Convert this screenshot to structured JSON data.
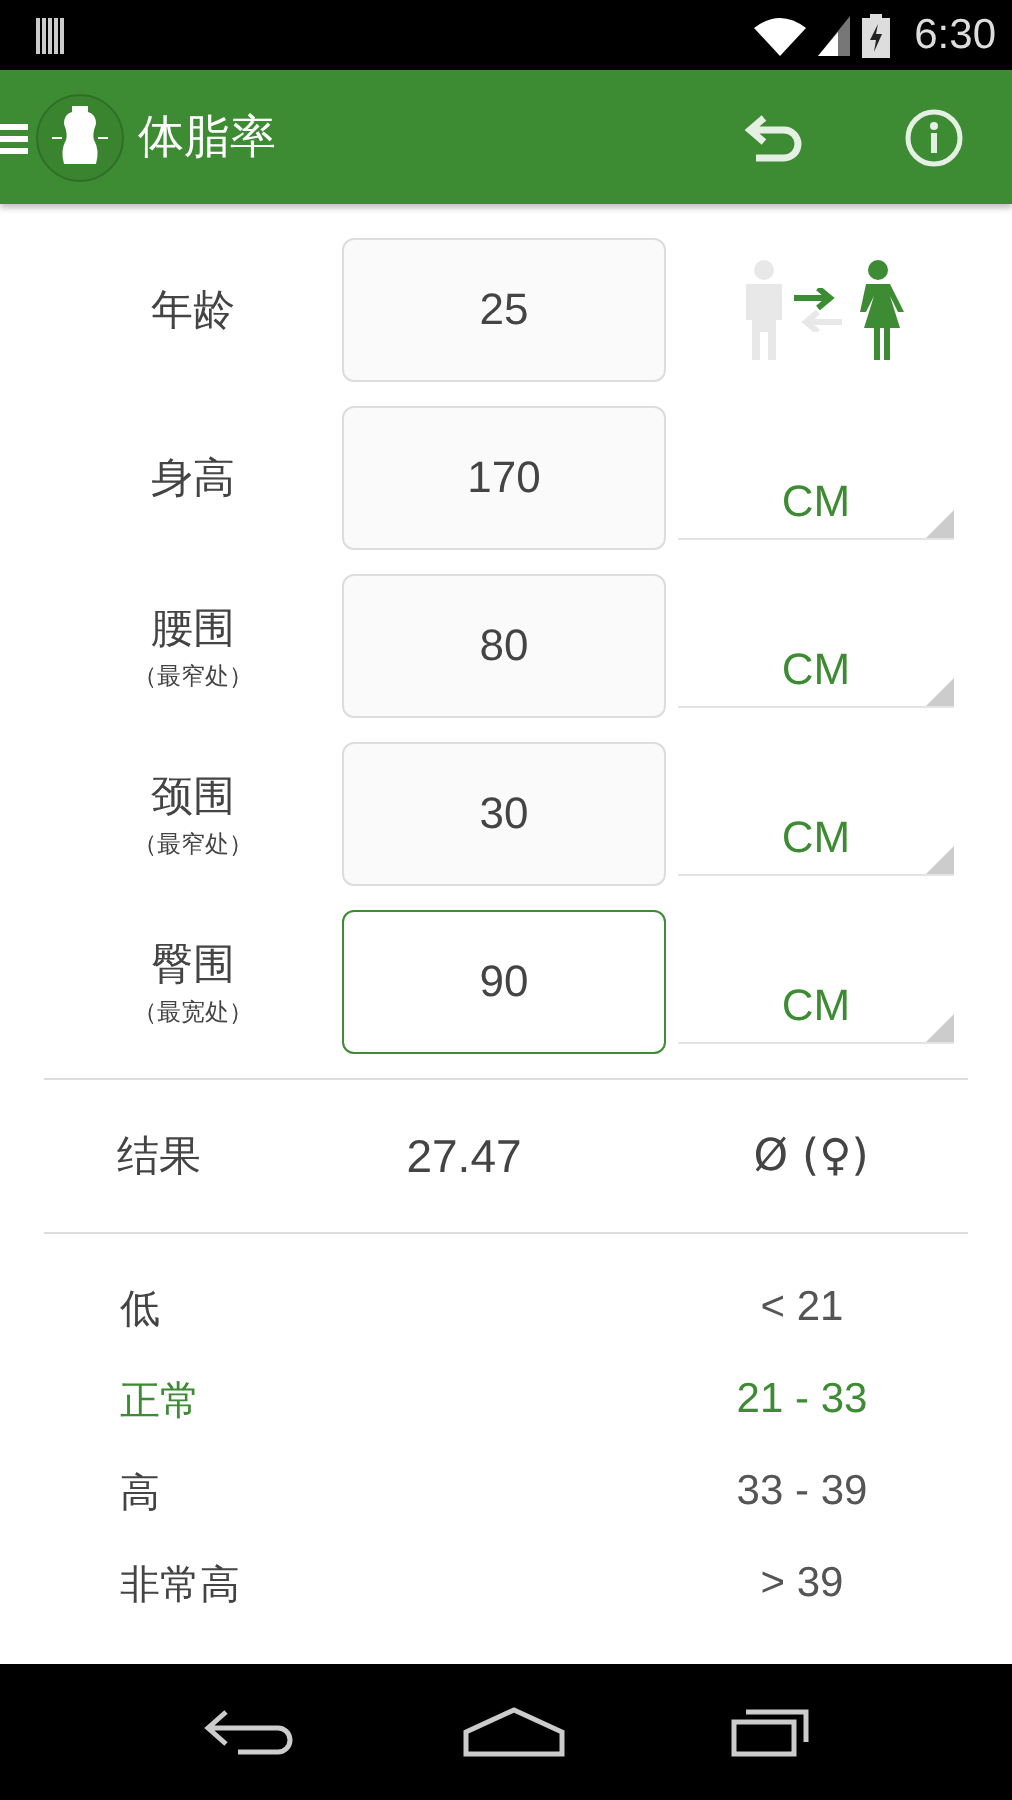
{
  "status_bar": {
    "time": "6:30"
  },
  "app_bar": {
    "title": "体脂率"
  },
  "gender_toggle": [
    {
      "kind": "male",
      "selected": false
    },
    {
      "kind": "female",
      "selected": true
    }
  ],
  "fields": [
    {
      "label": "年龄",
      "value": "25",
      "focused": false
    },
    {
      "label": "身高",
      "value": "170",
      "unit": "CM",
      "focused": false
    },
    {
      "label": "腰围",
      "note": "（最窄处）",
      "value": "80",
      "unit": "CM",
      "focused": false
    },
    {
      "label": "颈围",
      "note": "（最窄处）",
      "value": "30",
      "unit": "CM",
      "focused": false
    },
    {
      "label": "臀围",
      "note": "（最宽处）",
      "value": "90",
      "unit": "CM",
      "focused": true
    }
  ],
  "result": {
    "label": "结果",
    "value": "27.47",
    "average": "Ø (♀)"
  },
  "ranges": [
    {
      "name": "低",
      "range": "< 21",
      "current": false
    },
    {
      "name": "正常",
      "range": "21 - 33",
      "current": true
    },
    {
      "name": "高",
      "range": "33 - 39",
      "current": false
    },
    {
      "name": "非常高",
      "range": "> 39",
      "current": false
    }
  ]
}
